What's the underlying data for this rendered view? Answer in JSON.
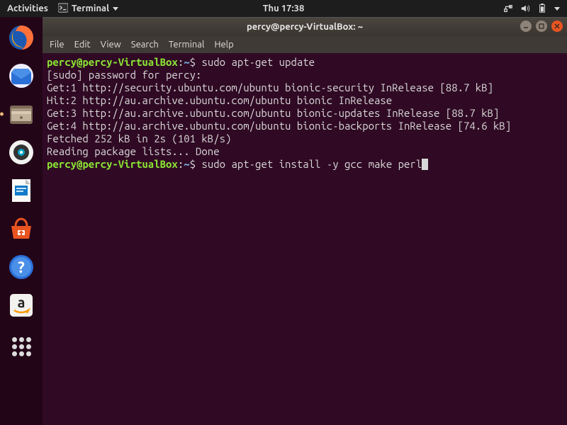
{
  "top_panel": {
    "activities": "Activities",
    "app_name": "Terminal",
    "clock": "Thu 17:38"
  },
  "window": {
    "title": "percy@percy-VirtualBox: ~"
  },
  "menubar": {
    "file": "File",
    "edit": "Edit",
    "view": "View",
    "search": "Search",
    "terminal": "Terminal",
    "help": "Help"
  },
  "terminal": {
    "prompt_user_host": "percy@percy-VirtualBox",
    "prompt_path": "~",
    "colon": ":",
    "dollar": "$ ",
    "cmd1": "sudo apt-get update",
    "out1": "[sudo] password for percy:",
    "out2": "Get:1 http://security.ubuntu.com/ubuntu bionic-security InRelease [88.7 kB]",
    "out3": "Hit:2 http://au.archive.ubuntu.com/ubuntu bionic InRelease",
    "out4": "Get:3 http://au.archive.ubuntu.com/ubuntu bionic-updates InRelease [88.7 kB]",
    "out5": "Get:4 http://au.archive.ubuntu.com/ubuntu bionic-backports InRelease [74.6 kB]",
    "out6": "Fetched 252 kB in 2s (101 kB/s)",
    "out7": "Reading package lists... Done",
    "cmd2": "sudo apt-get install -y gcc make perl"
  }
}
